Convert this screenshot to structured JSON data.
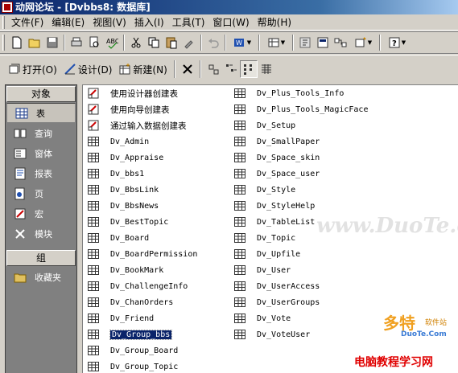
{
  "window": {
    "title": "动网论坛 - [Dvbbs8: 数据库]"
  },
  "menu": [
    "文件(F)",
    "编辑(E)",
    "视图(V)",
    "插入(I)",
    "工具(T)",
    "窗口(W)",
    "帮助(H)"
  ],
  "db_toolbar": {
    "open": "打开(O)",
    "design": "设计(D)",
    "new": "新建(N)"
  },
  "objects_header": "对象",
  "objects": [
    {
      "label": "表",
      "icon": "table-icon"
    },
    {
      "label": "查询",
      "icon": "query-icon"
    },
    {
      "label": "窗体",
      "icon": "form-icon"
    },
    {
      "label": "报表",
      "icon": "report-icon"
    },
    {
      "label": "页",
      "icon": "page-icon"
    },
    {
      "label": "宏",
      "icon": "macro-icon"
    },
    {
      "label": "模块",
      "icon": "module-icon"
    }
  ],
  "groups_header": "组",
  "groups": [
    {
      "label": "收藏夹",
      "icon": "favorites-icon"
    }
  ],
  "list_column1": [
    {
      "label": "使用设计器创建表",
      "kind": "shortcut"
    },
    {
      "label": "使用向导创建表",
      "kind": "shortcut"
    },
    {
      "label": "通过输入数据创建表",
      "kind": "shortcut"
    },
    {
      "label": "Dv_Admin",
      "kind": "table"
    },
    {
      "label": "Dv_Appraise",
      "kind": "table"
    },
    {
      "label": "Dv_bbs1",
      "kind": "table"
    },
    {
      "label": "Dv_BbsLink",
      "kind": "table"
    },
    {
      "label": "Dv_BbsNews",
      "kind": "table"
    },
    {
      "label": "Dv_BestTopic",
      "kind": "table"
    },
    {
      "label": "Dv_Board",
      "kind": "table"
    },
    {
      "label": "Dv_BoardPermission",
      "kind": "table"
    },
    {
      "label": "Dv_BookMark",
      "kind": "table"
    },
    {
      "label": "Dv_ChallengeInfo",
      "kind": "table"
    },
    {
      "label": "Dv_ChanOrders",
      "kind": "table"
    },
    {
      "label": "Dv_Friend",
      "kind": "table"
    },
    {
      "label": "Dv_Group_bbs",
      "kind": "table",
      "selected": true
    },
    {
      "label": "Dv_Group_Board",
      "kind": "table"
    },
    {
      "label": "Dv_Group_Topic",
      "kind": "table"
    }
  ],
  "list_column2": [
    {
      "label": "Dv_Plus_Tools_Info",
      "kind": "table"
    },
    {
      "label": "Dv_Plus_Tools_MagicFace",
      "kind": "table"
    },
    {
      "label": "Dv_Setup",
      "kind": "table"
    },
    {
      "label": "Dv_SmallPaper",
      "kind": "table"
    },
    {
      "label": "Dv_Space_skin",
      "kind": "table"
    },
    {
      "label": "Dv_Space_user",
      "kind": "table"
    },
    {
      "label": "Dv_Style",
      "kind": "table"
    },
    {
      "label": "Dv_StyleHelp",
      "kind": "table"
    },
    {
      "label": "Dv_TableList",
      "kind": "table"
    },
    {
      "label": "Dv_Topic",
      "kind": "table"
    },
    {
      "label": "Dv_Upfile",
      "kind": "table"
    },
    {
      "label": "Dv_User",
      "kind": "table"
    },
    {
      "label": "Dv_UserAccess",
      "kind": "table"
    },
    {
      "label": "Dv_UserGroups",
      "kind": "table"
    },
    {
      "label": "Dv_Vote",
      "kind": "table"
    },
    {
      "label": "Dv_VoteUser",
      "kind": "table"
    }
  ],
  "watermarks": {
    "center": "www.DuoTe.com",
    "logo_big": "多特",
    "logo_small": "软件站",
    "logo_url": "DuoTe.Com",
    "footer": "电脑教程学习网"
  },
  "colors": {
    "titlebar": "#0a246a",
    "selection": "#0a246a",
    "face": "#d4d0c8",
    "objbar": "#808080"
  }
}
